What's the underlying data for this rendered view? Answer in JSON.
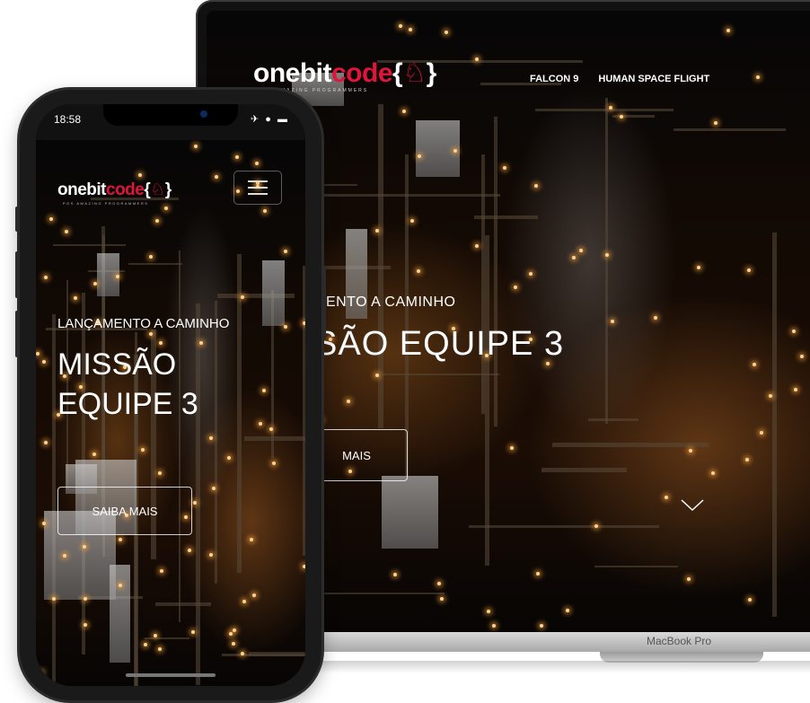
{
  "brand": {
    "logo_part1": "onebit",
    "logo_part2": "code",
    "logo_brace_open": "{",
    "logo_brace_close": "}",
    "logo_glyph": "♘",
    "tagline": "POS AMAZING PROGRAMMERS"
  },
  "laptop": {
    "menu": [
      "FALCON 9",
      "HUMAN SPACE FLIGHT"
    ],
    "hero_subtitle": "IENTO A CAMINHO",
    "hero_title": "SÃO EQUIPE 3",
    "cta": "MAIS",
    "device_label": "MacBook Pro"
  },
  "phone": {
    "status_time": "18:58",
    "status_icons": "✈ ● ▬",
    "hero_subtitle": "LANÇAMENTO A CAMINHO",
    "hero_title": "MISSÃO EQUIPE 3",
    "cta": "SAIBA MAIS"
  },
  "colors": {
    "accent": "#e0153a",
    "text": "#ffffff"
  }
}
